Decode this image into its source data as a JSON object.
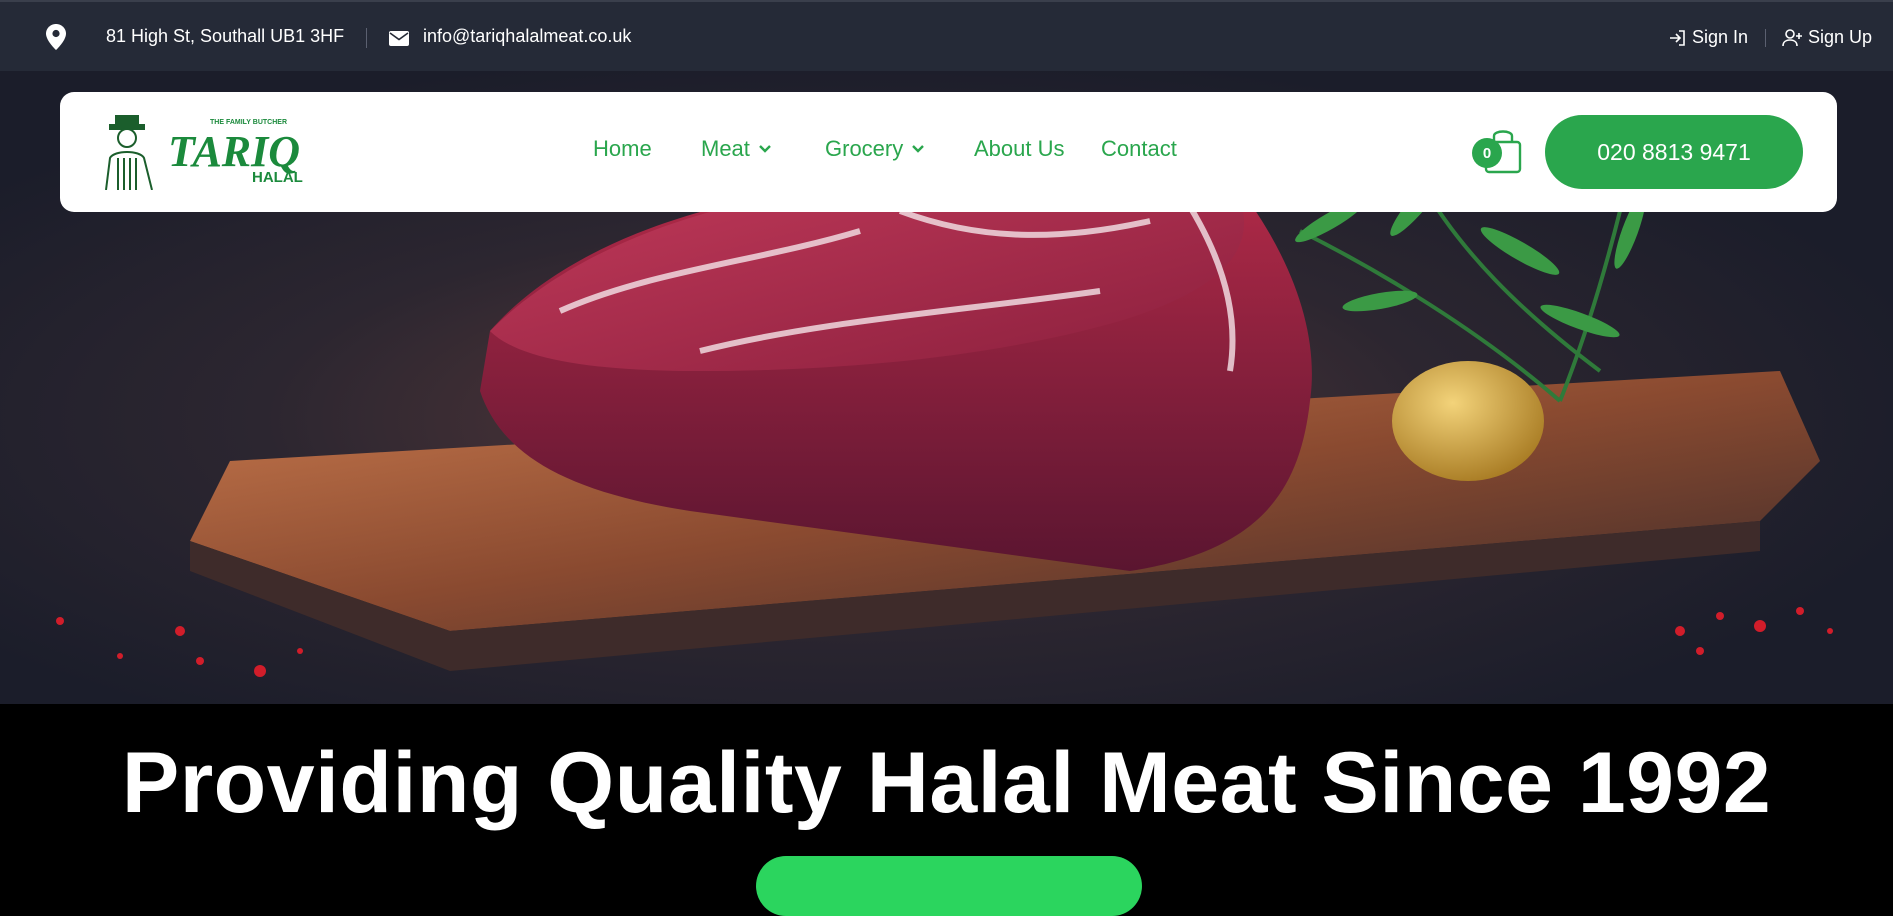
{
  "topbar": {
    "address": "81 High St, Southall UB1 3HF",
    "email": "info@tariqhalalmeat.co.uk",
    "sign_in": "Sign In",
    "sign_up": "Sign Up"
  },
  "logo": {
    "tagline": "THE FAMILY BUTCHER",
    "name": "TARIQ",
    "sub": "HALAL"
  },
  "nav": {
    "items": [
      {
        "label": "Home"
      },
      {
        "label": "Meat"
      },
      {
        "label": "Grocery"
      },
      {
        "label": "About Us"
      },
      {
        "label": "Contact"
      }
    ]
  },
  "cart": {
    "count": "0"
  },
  "phone": {
    "label": "020 8813 9471"
  },
  "hero": {
    "headline": "Providing Quality Halal Meat Since 1992"
  },
  "colors": {
    "brand_green": "#2aa64d",
    "topbar_bg": "#252a37",
    "cta_green": "#2bd55e"
  }
}
